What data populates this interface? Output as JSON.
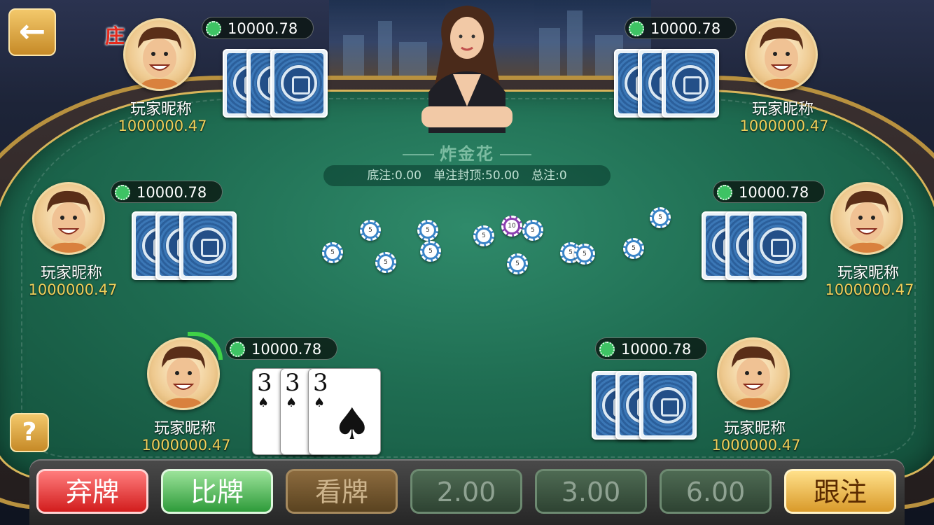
{
  "table": {
    "game_title": "炸金花",
    "base_bet": "底注:0.00",
    "single_cap": "单注封顶:50.00",
    "total_bet": "总注:0"
  },
  "banker_label": "庄",
  "back_icon": "arrow-left-icon",
  "help_label": "?",
  "players": [
    {
      "name": "玩家昵称",
      "money": "1000000.47",
      "bet": "10000.78"
    },
    {
      "name": "玩家昵称",
      "money": "1000000.47",
      "bet": "10000.78"
    },
    {
      "name": "玩家昵称",
      "money": "1000000.47",
      "bet": "10000.78"
    },
    {
      "name": "玩家昵称",
      "money": "1000000.47",
      "bet": "10000.78"
    },
    {
      "name": "玩家昵称",
      "money": "1000000.47",
      "bet": "10000.78"
    },
    {
      "name": "玩家昵称",
      "money": "1000000.47",
      "bet": "10000.78"
    }
  ],
  "my_cards": [
    {
      "rank": "3",
      "suit": "♠"
    },
    {
      "rank": "3",
      "suit": "♠"
    },
    {
      "rank": "3",
      "suit": "♠"
    }
  ],
  "chips": [
    "5",
    "5",
    "5",
    "5",
    "5",
    "10",
    "5",
    "5",
    "5",
    "5",
    "5",
    "5",
    "5"
  ],
  "actions": {
    "fold": "弃牌",
    "compare": "比牌",
    "look": "看牌",
    "bet1": "2.00",
    "bet2": "3.00",
    "bet3": "6.00",
    "follow": "跟注"
  }
}
